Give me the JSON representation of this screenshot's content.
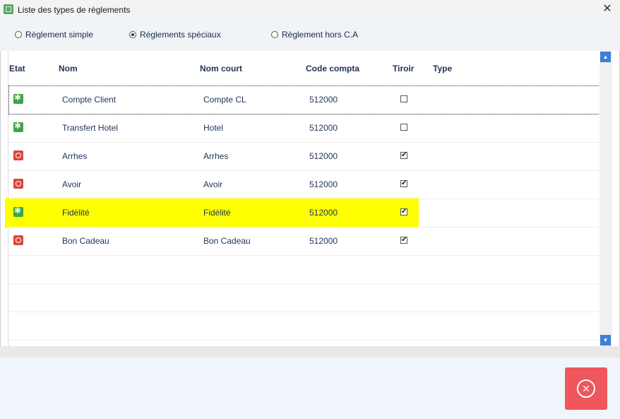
{
  "window": {
    "title": "Liste des types de règlements",
    "close_glyph": "✕"
  },
  "modes": [
    {
      "label": "Règlement simple",
      "selected": false
    },
    {
      "label": "Réglements spéciaux",
      "selected": true
    },
    {
      "label": "Règlement hors C.A",
      "selected": false
    }
  ],
  "columns": {
    "etat": "Etat",
    "nom": "Nom",
    "nom_court": "Nom court",
    "code_compta": "Code compta",
    "tiroir": "Tiroir",
    "type": "Type"
  },
  "rows": [
    {
      "state": "green",
      "nom": "Compte Client",
      "nom_court": "Compte CL",
      "code": "512000",
      "tiroir": false,
      "type": ""
    },
    {
      "state": "green",
      "nom": "Transfert Hotel",
      "nom_court": "Hotel",
      "code": "512000",
      "tiroir": false,
      "type": ""
    },
    {
      "state": "red",
      "nom": "Arrhes",
      "nom_court": "Arrhes",
      "code": "512000",
      "tiroir": true,
      "type": ""
    },
    {
      "state": "red",
      "nom": "Avoir",
      "nom_court": "Avoir",
      "code": "512000",
      "tiroir": true,
      "type": ""
    },
    {
      "state": "green",
      "nom": "Fidélité",
      "nom_court": "Fidélité",
      "code": "512000",
      "tiroir": true,
      "type": ""
    },
    {
      "state": "red",
      "nom": "Bon Cadeau",
      "nom_court": "Bon Cadeau",
      "code": "512000",
      "tiroir": true,
      "type": ""
    }
  ],
  "check_glyph": "✔",
  "colors": {
    "accent": "#3c7fd6",
    "highlight": "#ffff00",
    "close_button": "#f0565e",
    "active_state": "#3fa34a",
    "inactive_state": "#d9473a"
  }
}
